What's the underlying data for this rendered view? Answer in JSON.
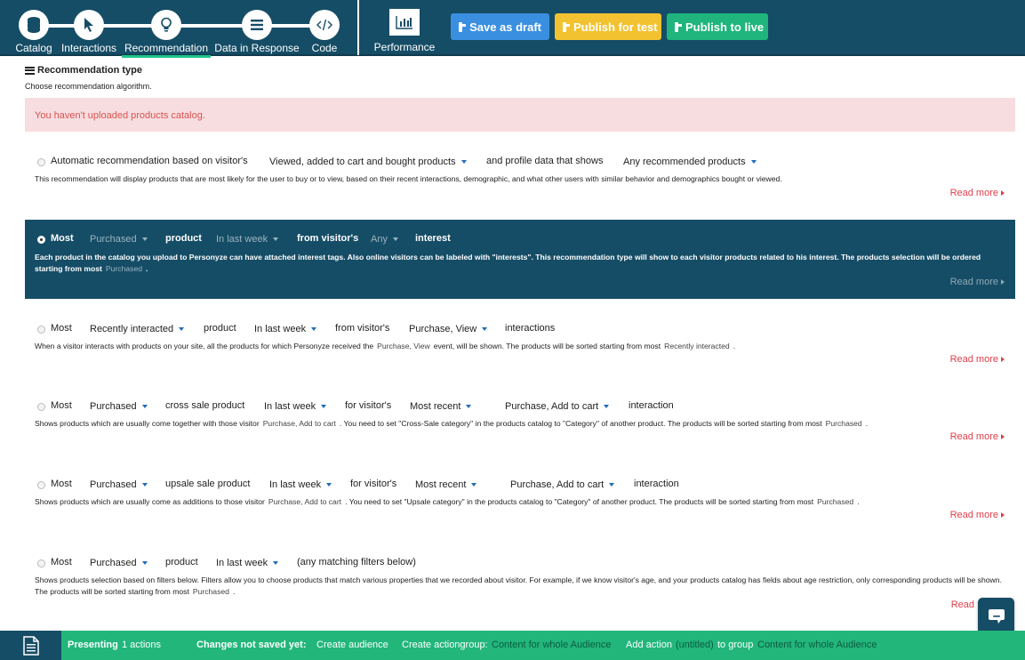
{
  "steps": [
    {
      "label": "Catalog",
      "icon": "database-icon"
    },
    {
      "label": "Interactions",
      "icon": "cursor-icon"
    },
    {
      "label": "Recommendation",
      "icon": "lightbulb-icon"
    },
    {
      "label": "Data in Response",
      "icon": "list-icon"
    },
    {
      "label": "Code",
      "icon": "code-icon"
    }
  ],
  "active_step": "Recommendation",
  "performance": {
    "label": "Performance",
    "icon": "bar-chart-icon"
  },
  "toolbar": {
    "save_draft": "Save as draft",
    "publish_test": "Publish for test",
    "publish_live": "Publish to live"
  },
  "colors": {
    "topbar": "#164d66",
    "active_underline": "#20c58a",
    "draft": "#3b8fe0",
    "test": "#f2c230",
    "live": "#1fb57d",
    "alert_bg": "#f7dde0",
    "alert_text": "#d9534f",
    "read_more": "#e03e4a",
    "bottombar": "#22b67b"
  },
  "section": {
    "title": "Recommendation type",
    "subtitle": "Choose recommendation algorithm.",
    "alert": "You haven't uploaded products catalog."
  },
  "options": [
    {
      "id": "automatic",
      "selected": false,
      "line": {
        "t1": "Automatic recommendation based on visitor's",
        "d1": "Viewed, added to cart and bought products",
        "t2": "and profile data that shows",
        "d2": "Any recommended products"
      },
      "desc": "This recommendation will display products that are most likely for the user to buy or to view, based on their recent interactions, demographic, and what other users with similar behavior and demographics bought or viewed.",
      "read_more": "Read more"
    },
    {
      "id": "interest",
      "selected": true,
      "line": {
        "t1": "Most",
        "d1": "Purchased",
        "t2": "product",
        "d2": "In last week",
        "t3": "from visitor's",
        "d3": "Any",
        "t4": "interest"
      },
      "desc_a": "Each product in the catalog you upload to Personyze can have attached interest tags. Also online visitors can be labeled with \"interests\". This recommendation type will show to each visitor products related to his interest. The products selection will be ordered starting from most",
      "desc_hl": "Purchased",
      "desc_b": ".",
      "read_more": "Read more"
    },
    {
      "id": "interactions",
      "selected": false,
      "line": {
        "t1": "Most",
        "d1": "Recently interacted",
        "t2": "product",
        "d2": "In last week",
        "t3": "from visitor's",
        "d3": "Purchase, View",
        "t4": "interactions"
      },
      "desc_a": "When a visitor interacts with products on your site, all the products for which Personyze received the",
      "desc_hl": "Purchase, View",
      "desc_b": "event, will be shown. The products will be sorted starting from most",
      "desc_hl2": "Recently interacted",
      "desc_c": ".",
      "read_more": "Read more"
    },
    {
      "id": "cross-sale",
      "selected": false,
      "line": {
        "t1": "Most",
        "d1": "Purchased",
        "t2": "cross sale product",
        "d2": "In last week",
        "t3": "for visitor's",
        "d3": "Most recent",
        "d4": "Purchase, Add to cart",
        "t4": "interaction"
      },
      "desc_a": "Shows products which are usually come together with those visitor",
      "desc_hl": "Purchase, Add to cart",
      "desc_b": ". You need to set \"Cross-Sale category\" in the products catalog to \"Category\" of another product. The products will be sorted starting from most",
      "desc_hl2": "Purchased",
      "desc_c": ".",
      "read_more": "Read more"
    },
    {
      "id": "upsale",
      "selected": false,
      "line": {
        "t1": "Most",
        "d1": "Purchased",
        "t2": "upsale sale product",
        "d2": "In last week",
        "t3": "for visitor's",
        "d3": "Most recent",
        "d4": "Purchase, Add to cart",
        "t4": "interaction"
      },
      "desc_a": "Shows products which are usually come as additions to those visitor",
      "desc_hl": "Purchase, Add to cart",
      "desc_b": ". You need to set \"Upsale category\" in the products catalog to \"Category\" of another product. The products will be sorted starting from most",
      "desc_hl2": "Purchased",
      "desc_c": ".",
      "read_more": "Read more"
    },
    {
      "id": "filters",
      "selected": false,
      "line": {
        "t1": "Most",
        "d1": "Purchased",
        "t2": "product",
        "d2": "In last week",
        "t3": "(any matching filters below)"
      },
      "desc_a": "Shows products selection based on filters below. Filters allow you to choose products that match various properties that we recorded about visitor. For example, if we know visitor's age, and your products catalog has fields about age restriction, only corresponding products will be shown. The products will be sorted starting from most",
      "desc_hl": "Purchased",
      "desc_b": ".",
      "read_more": "Read"
    }
  ],
  "bottombar": {
    "presenting_label": "Presenting",
    "presenting_count": "1 actions",
    "changes_label": "Changes not saved yet:",
    "create_audience": "Create audience",
    "create_actiongroup": "Create actiongroup:",
    "actiongroup_name": "Content for whole Audience",
    "add_action": "Add action",
    "untitled": "(untitled)",
    "to_group": "to group",
    "group_name": "Content for whole Audience"
  }
}
